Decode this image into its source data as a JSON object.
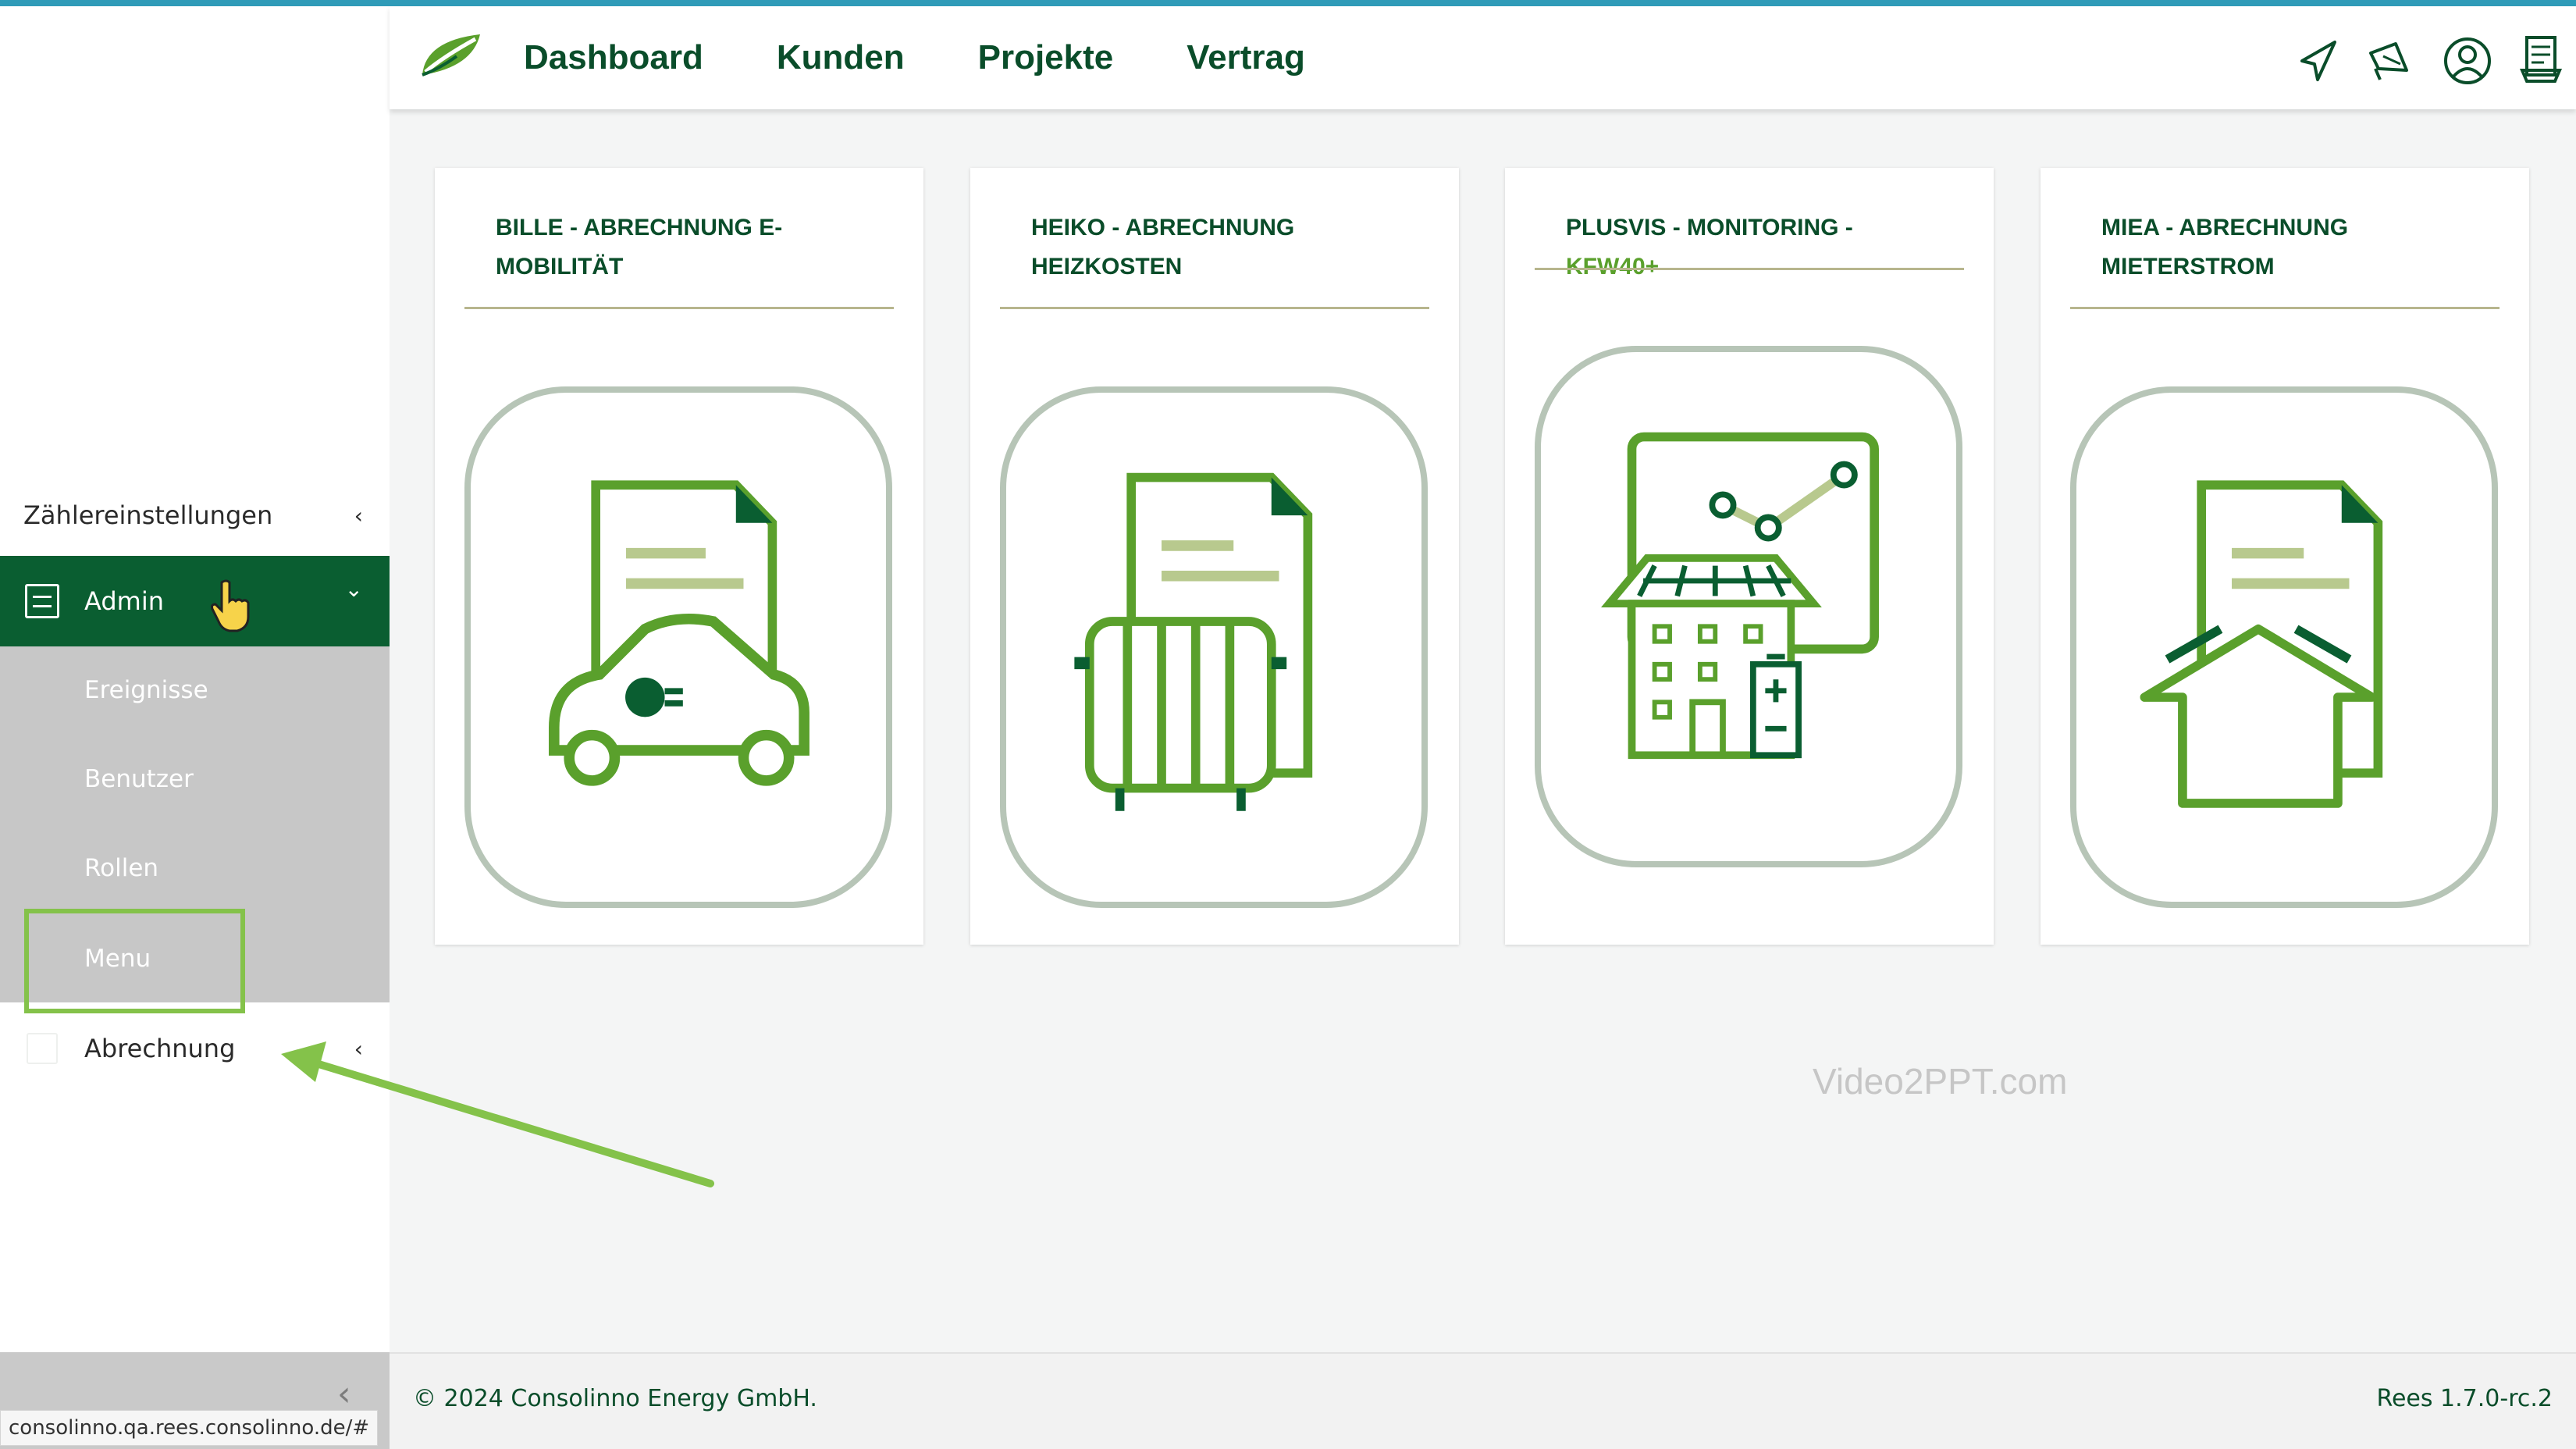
{
  "header": {
    "nav": [
      "Dashboard",
      "Kunden",
      "Projekte",
      "Vertrag"
    ],
    "icons": [
      "send-icon",
      "megaphone-icon",
      "user-profile-icon",
      "document-list-icon"
    ]
  },
  "sidebar": {
    "zahler": "Zählereinstellungen",
    "admin": "Admin",
    "sub_items": [
      "Ereignisse",
      "Benutzer",
      "Rollen",
      "Menu"
    ],
    "abrechnung": "Abrechnung",
    "chevron_left": "‹",
    "chevron_down": "⌄"
  },
  "cards": [
    {
      "title_part1": "BILLE - ABRECHNUNG E-MOBILITÄT",
      "title_part2": "",
      "icon": "ev-car-invoice-icon"
    },
    {
      "title_part1": "HEIKO - ABRECHNUNG HEIZKOSTEN",
      "title_part2": "",
      "icon": "radiator-invoice-icon"
    },
    {
      "title_part1": "PLUSVIS - MONITORING - ",
      "title_part2": "KFW40+",
      "icon": "solar-house-monitoring-icon"
    },
    {
      "title_part1": "MIEA - ABRECHNUNG MIETERSTROM",
      "title_part2": "",
      "icon": "house-invoice-icon"
    }
  ],
  "watermark": "Video2PPT.com",
  "footer": {
    "copyright": "© 2024 Consolinno Energy GmbH.",
    "version": "Rees 1.7.0-rc.2"
  },
  "status_url": "consolinno.qa.rees.consolinno.de/#",
  "colors": {
    "brand_dark": "#0a5e31",
    "brand_light": "#5aa02c",
    "highlight": "#84c24a",
    "accent_top": "#2f9bb8"
  }
}
